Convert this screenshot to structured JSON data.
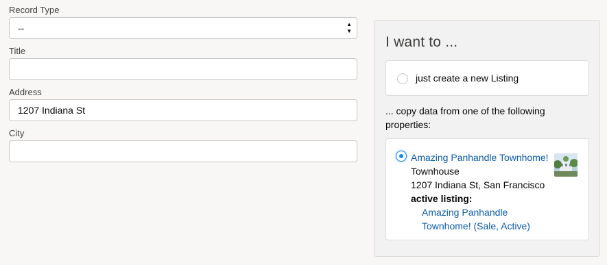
{
  "form": {
    "record_type": {
      "label": "Record Type",
      "value": "--"
    },
    "title": {
      "label": "Title",
      "value": ""
    },
    "address": {
      "label": "Address",
      "value": "1207 Indiana St"
    },
    "city": {
      "label": "City",
      "value": ""
    }
  },
  "panel": {
    "title": "I want to ...",
    "new_listing_label": "just create a new Listing",
    "copy_prompt": "... copy data from one of the following properties:",
    "property": {
      "name": "Amazing Panhandle Townhome!",
      "type": "Townhouse",
      "address": "1207 Indiana St, San Francisco",
      "active_listing_label": "active listing:",
      "listing_line1": "Amazing Panhandle",
      "listing_line2": "Townhome! (Sale, Active)",
      "thumbnail_icon": "property-photo-icon"
    },
    "selected_option": "copy-property"
  },
  "colors": {
    "link": "#0b5cab",
    "radio_selected": "#1589ee",
    "panel_bg": "#f3f2f2"
  }
}
